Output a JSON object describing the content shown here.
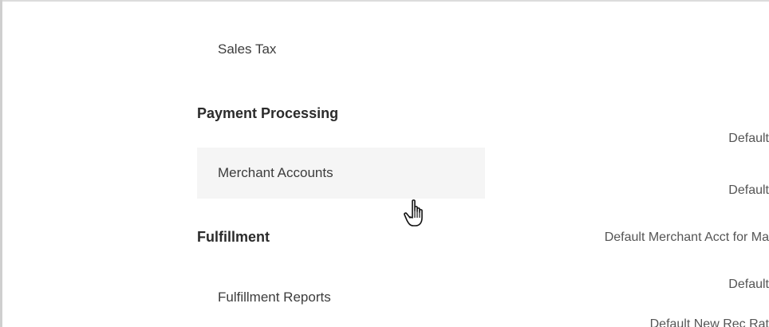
{
  "nav": {
    "sales_tax": "Sales Tax",
    "payment_processing_heading": "Payment Processing",
    "merchant_accounts": "Merchant Accounts",
    "fulfillment_heading": "Fulfillment",
    "fulfillment_reports": "Fulfillment Reports",
    "active_item": "Merchant Accounts"
  },
  "settings": {
    "row1": "Default",
    "row2": "Default",
    "row3": "Default Merchant Acct for Ma",
    "row4": "Default",
    "row5": "Default New Rec Rat"
  },
  "colors": {
    "active_background": "#f5f5f5",
    "heading": "#2b2b2b",
    "text": "#3c3c3c",
    "border": "#dcdcdc"
  },
  "icons": {
    "cursor": "hand-pointer-icon"
  }
}
